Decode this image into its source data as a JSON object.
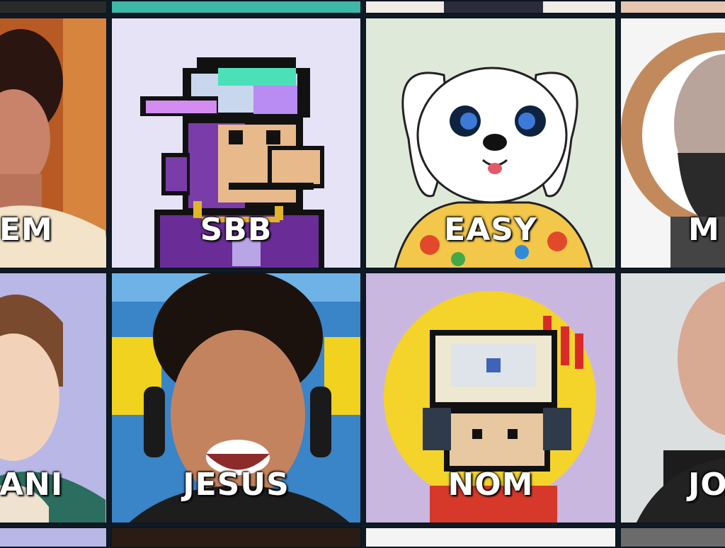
{
  "grid": {
    "row1": [
      {
        "label": ""
      },
      {
        "label": ""
      },
      {
        "label": ""
      },
      {
        "label": ""
      }
    ],
    "row2": [
      {
        "label": "EM"
      },
      {
        "label": "SBB"
      },
      {
        "label": "EASY"
      },
      {
        "label": "M"
      }
    ],
    "row3": [
      {
        "label": "ANI"
      },
      {
        "label": "JESUS"
      },
      {
        "label": "NOM"
      },
      {
        "label": "JO"
      }
    ]
  },
  "colors": {
    "grid_line": "#0f1a24",
    "sbb_bg": "#e6e3f6",
    "easy_bg": "#dfe9da",
    "nom_bg": "#c9b7e0",
    "ani_bg": "#b9b7e6",
    "label": "#ffffff"
  }
}
